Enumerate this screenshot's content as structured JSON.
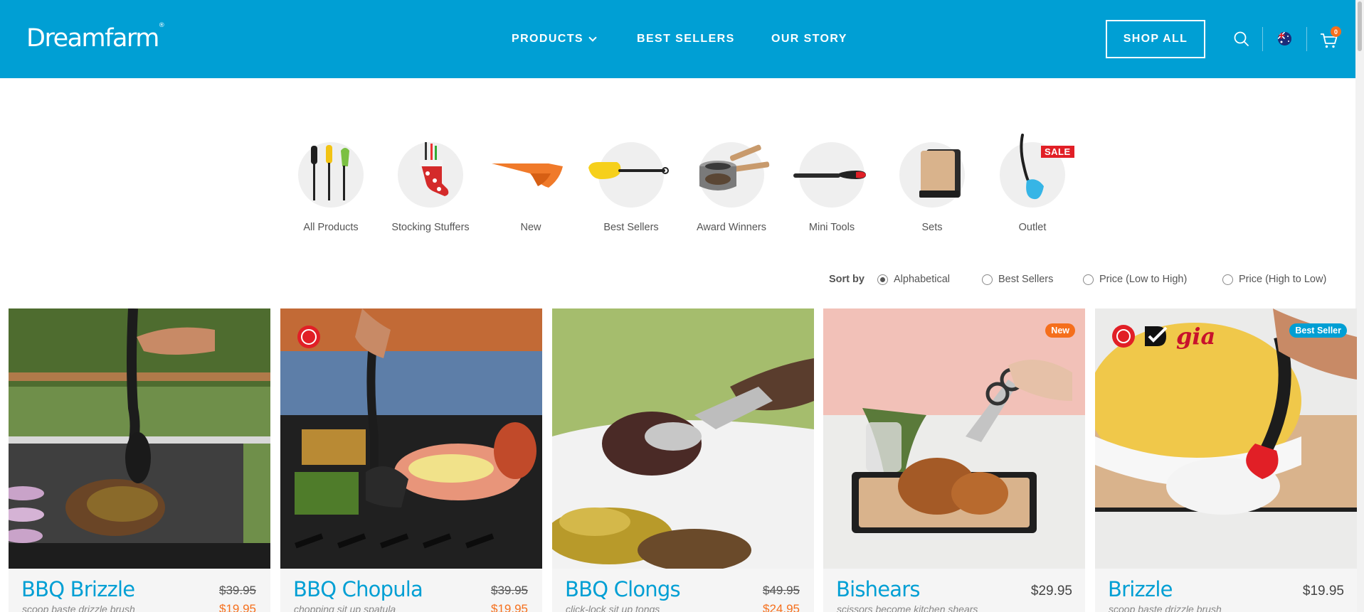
{
  "header": {
    "logo": "Dreamfarm",
    "logo_mark": "®",
    "nav": {
      "products": "PRODUCTS",
      "best_sellers": "BEST SELLERS",
      "our_story": "OUR STORY"
    },
    "shop_all": "SHOP ALL",
    "cart_count": "0",
    "icons": [
      "search-icon",
      "australia-flag-icon",
      "cart-icon"
    ],
    "brand_color": "#009fd4"
  },
  "categories": [
    {
      "label": "All Products"
    },
    {
      "label": "Stocking Stuffers"
    },
    {
      "label": "New"
    },
    {
      "label": "Best Sellers"
    },
    {
      "label": "Award Winners"
    },
    {
      "label": "Mini Tools"
    },
    {
      "label": "Sets"
    },
    {
      "label": "Outlet",
      "tag": "SALE"
    }
  ],
  "sort": {
    "label": "Sort by",
    "options": [
      "Alphabetical",
      "Best Sellers",
      "Price (Low to High)",
      "Price (High to Low)"
    ],
    "selected": "Alphabetical"
  },
  "products": [
    {
      "name": "BBQ Brizzle",
      "subtitle": "scoop baste drizzle brush",
      "price_old": "$39.95",
      "price_sale": "$19.95"
    },
    {
      "name": "BBQ Chopula",
      "subtitle": "chopping sit up spatula",
      "price_old": "$39.95",
      "price_sale": "$19.95"
    },
    {
      "name": "BBQ Clongs",
      "subtitle": "click-lock sit up tongs",
      "price_old": "$49.95",
      "price_sale": "$24.95"
    },
    {
      "name": "Bishears",
      "subtitle": "scissors become kitchen shears",
      "price": "$29.95",
      "badge": "New"
    },
    {
      "name": "Brizzle",
      "subtitle": "scoop baste drizzle brush",
      "price": "$19.95",
      "badge": "Best Seller",
      "award_text": "gia"
    }
  ],
  "colors": {
    "sale_price": "#f56f1c",
    "new_badge": "#f56f1c",
    "best_seller_badge": "#009fd4",
    "sale_tag": "#e11f26"
  }
}
